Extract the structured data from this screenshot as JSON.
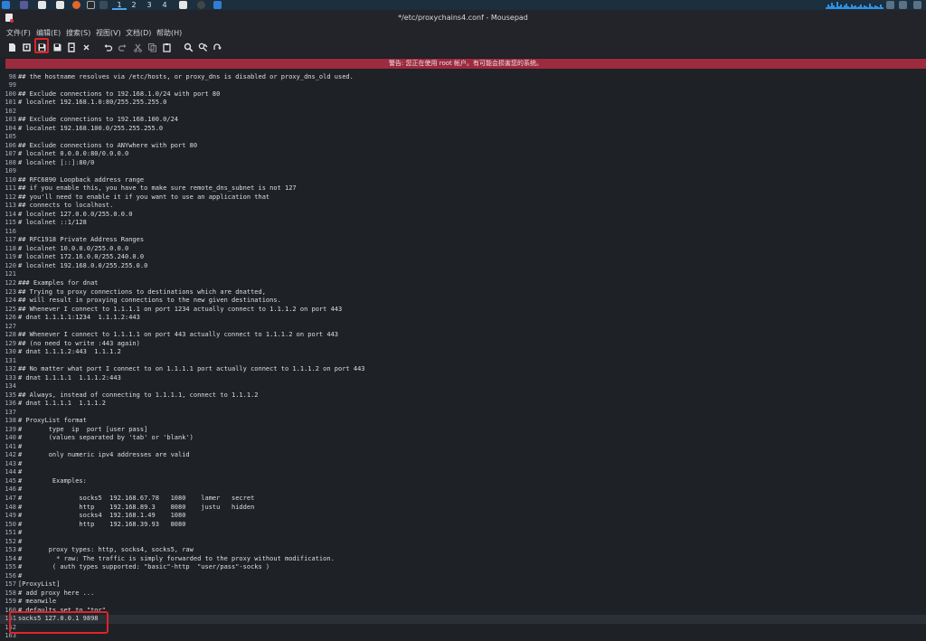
{
  "taskbar": {
    "workspaces": [
      "1",
      "2",
      "3",
      "4"
    ]
  },
  "window": {
    "title": "*/etc/proxychains4.conf - Mousepad"
  },
  "menu": {
    "items": [
      "文件(F)",
      "编辑(E)",
      "搜索(S)",
      "视图(V)",
      "文档(D)",
      "帮助(H)"
    ]
  },
  "toolbar": {
    "icons": [
      "new-document-icon",
      "new-window-icon",
      "open-icon",
      "save-icon",
      "save-as-icon",
      "reload-icon",
      "close-icon",
      "undo-icon",
      "redo-icon",
      "cut-icon",
      "copy-icon",
      "paste-icon",
      "find-icon",
      "find-replace-icon",
      "goto-line-icon"
    ]
  },
  "warning": {
    "text": "警告: 您正在使用 root 帐户。有可能会损害您的系统。"
  },
  "editor": {
    "lines": [
      {
        "n": "98",
        "t": "## the hostname resolves via /etc/hosts, or proxy_dns is disabled or proxy_dns_old used."
      },
      {
        "n": "99",
        "t": ""
      },
      {
        "n": "100",
        "t": "## Exclude connections to 192.168.1.0/24 with port 80"
      },
      {
        "n": "101",
        "t": "# localnet 192.168.1.0:80/255.255.255.0"
      },
      {
        "n": "102",
        "t": ""
      },
      {
        "n": "103",
        "t": "## Exclude connections to 192.168.100.0/24"
      },
      {
        "n": "104",
        "t": "# localnet 192.168.100.0/255.255.255.0"
      },
      {
        "n": "105",
        "t": ""
      },
      {
        "n": "106",
        "t": "## Exclude connections to ANYwhere with port 80"
      },
      {
        "n": "107",
        "t": "# localnet 0.0.0.0:80/0.0.0.0"
      },
      {
        "n": "108",
        "t": "# localnet [::]:80/0"
      },
      {
        "n": "109",
        "t": ""
      },
      {
        "n": "110",
        "t": "## RFC6890 Loopback address range"
      },
      {
        "n": "111",
        "t": "## if you enable this, you have to make sure remote_dns_subnet is not 127"
      },
      {
        "n": "112",
        "t": "## you'll need to enable it if you want to use an application that"
      },
      {
        "n": "113",
        "t": "## connects to localhost."
      },
      {
        "n": "114",
        "t": "# localnet 127.0.0.0/255.0.0.0"
      },
      {
        "n": "115",
        "t": "# localnet ::1/128"
      },
      {
        "n": "116",
        "t": ""
      },
      {
        "n": "117",
        "t": "## RFC1918 Private Address Ranges"
      },
      {
        "n": "118",
        "t": "# localnet 10.0.0.0/255.0.0.0"
      },
      {
        "n": "119",
        "t": "# localnet 172.16.0.0/255.240.0.0"
      },
      {
        "n": "120",
        "t": "# localnet 192.168.0.0/255.255.0.0"
      },
      {
        "n": "121",
        "t": ""
      },
      {
        "n": "122",
        "t": "### Examples for dnat"
      },
      {
        "n": "123",
        "t": "## Trying to proxy connections to destinations which are dnatted,"
      },
      {
        "n": "124",
        "t": "## will result in proxying connections to the new given destinations."
      },
      {
        "n": "125",
        "t": "## Whenever I connect to 1.1.1.1 on port 1234 actually connect to 1.1.1.2 on port 443"
      },
      {
        "n": "126",
        "t": "# dnat 1.1.1.1:1234  1.1.1.2:443"
      },
      {
        "n": "127",
        "t": ""
      },
      {
        "n": "128",
        "t": "## Whenever I connect to 1.1.1.1 on port 443 actually connect to 1.1.1.2 on port 443"
      },
      {
        "n": "129",
        "t": "## (no need to write :443 again)"
      },
      {
        "n": "130",
        "t": "# dnat 1.1.1.2:443  1.1.1.2"
      },
      {
        "n": "131",
        "t": ""
      },
      {
        "n": "132",
        "t": "## No matter what port I connect to on 1.1.1.1 port actually connect to 1.1.1.2 on port 443"
      },
      {
        "n": "133",
        "t": "# dnat 1.1.1.1  1.1.1.2:443"
      },
      {
        "n": "134",
        "t": ""
      },
      {
        "n": "135",
        "t": "## Always, instead of connecting to 1.1.1.1, connect to 1.1.1.2"
      },
      {
        "n": "136",
        "t": "# dnat 1.1.1.1  1.1.1.2"
      },
      {
        "n": "137",
        "t": ""
      },
      {
        "n": "138",
        "t": "# ProxyList format"
      },
      {
        "n": "139",
        "t": "#       type  ip  port [user pass]"
      },
      {
        "n": "140",
        "t": "#       (values separated by 'tab' or 'blank')"
      },
      {
        "n": "141",
        "t": "#"
      },
      {
        "n": "142",
        "t": "#       only numeric ipv4 addresses are valid"
      },
      {
        "n": "143",
        "t": "#"
      },
      {
        "n": "144",
        "t": "#"
      },
      {
        "n": "145",
        "t": "#        Examples:"
      },
      {
        "n": "146",
        "t": "#"
      },
      {
        "n": "147",
        "t": "#               socks5  192.168.67.78   1080    lamer   secret"
      },
      {
        "n": "148",
        "t": "#               http    192.168.89.3    8080    justu   hidden"
      },
      {
        "n": "149",
        "t": "#               socks4  192.168.1.49    1080"
      },
      {
        "n": "150",
        "t": "#               http    192.168.39.93   8080"
      },
      {
        "n": "151",
        "t": "#"
      },
      {
        "n": "152",
        "t": "#"
      },
      {
        "n": "153",
        "t": "#       proxy types: http, socks4, socks5, raw"
      },
      {
        "n": "154",
        "t": "#         * raw: The traffic is simply forwarded to the proxy without modification."
      },
      {
        "n": "155",
        "t": "#        ( auth types supported: \"basic\"-http  \"user/pass\"-socks )"
      },
      {
        "n": "156",
        "t": "#"
      },
      {
        "n": "157",
        "t": "[ProxyList]"
      },
      {
        "n": "158",
        "t": "# add proxy here ..."
      },
      {
        "n": "159",
        "t": "# meanwile"
      },
      {
        "n": "160",
        "t": "# defaults set to \"tor\""
      },
      {
        "n": "161",
        "t": "socks5 127.0.0.1 9898"
      },
      {
        "n": "162",
        "t": ""
      },
      {
        "n": "163",
        "t": ""
      }
    ],
    "current_line": "161"
  },
  "colors": {
    "warning_bg": "#9c2b3f",
    "highlight_box": "#e0232a"
  }
}
